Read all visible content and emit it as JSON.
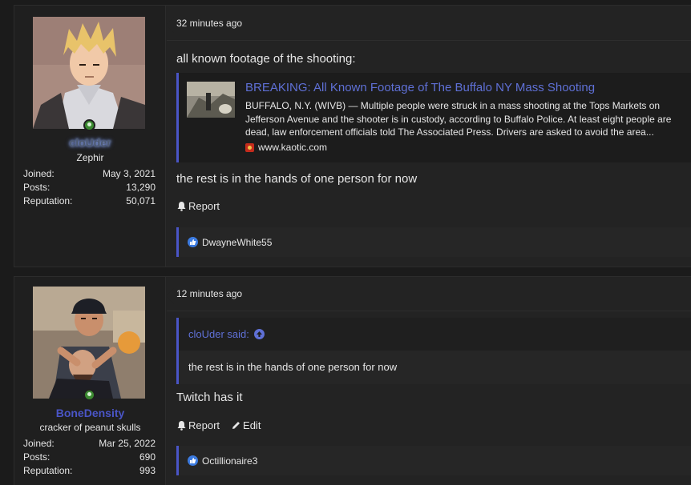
{
  "posts": [
    {
      "user": {
        "username": "cloUder",
        "title": "Zephir",
        "stats": [
          {
            "label": "Joined:",
            "value": "May 3, 2021"
          },
          {
            "label": "Posts:",
            "value": "13,290"
          },
          {
            "label": "Reputation:",
            "value": "50,071"
          }
        ]
      },
      "time": "32 minutes ago",
      "intro_text": "all known footage of the shooting:",
      "embed": {
        "title": "BREAKING: All Known Footage of The Buffalo NY Mass Shooting",
        "description": "BUFFALO, N.Y. (WIVB) — Multiple people were struck in a mass shooting at the Tops Markets on Jefferson Avenue and the shooter is in custody, according to Buffalo Police. At least eight people are dead, law enforcement officials told The Associated Press. Drivers are asked to avoid the area...",
        "site": "www.kaotic.com"
      },
      "body_text": "the rest is in the hands of one person for now",
      "actions": {
        "report": "Report"
      },
      "reactions": {
        "user": "DwayneWhite55"
      }
    },
    {
      "user": {
        "username": "BoneDensity",
        "title": "cracker of peanut skulls",
        "stats": [
          {
            "label": "Joined:",
            "value": "Mar 25, 2022"
          },
          {
            "label": "Posts:",
            "value": "690"
          },
          {
            "label": "Reputation:",
            "value": "993"
          }
        ]
      },
      "time": "12 minutes ago",
      "quote": {
        "author": "cloUder said:",
        "text": "the rest is in the hands of one person for now"
      },
      "body_text": "Twitch has it",
      "actions": {
        "report": "Report",
        "edit": "Edit"
      },
      "reactions": {
        "user": "Octillionaire3"
      }
    }
  ],
  "colors": {
    "accent": "#4a55c7",
    "link": "#5f70d6",
    "background": "#1b1b1b",
    "panel": "#232323",
    "online": "#3b8a31",
    "like": "#3c7be0"
  }
}
